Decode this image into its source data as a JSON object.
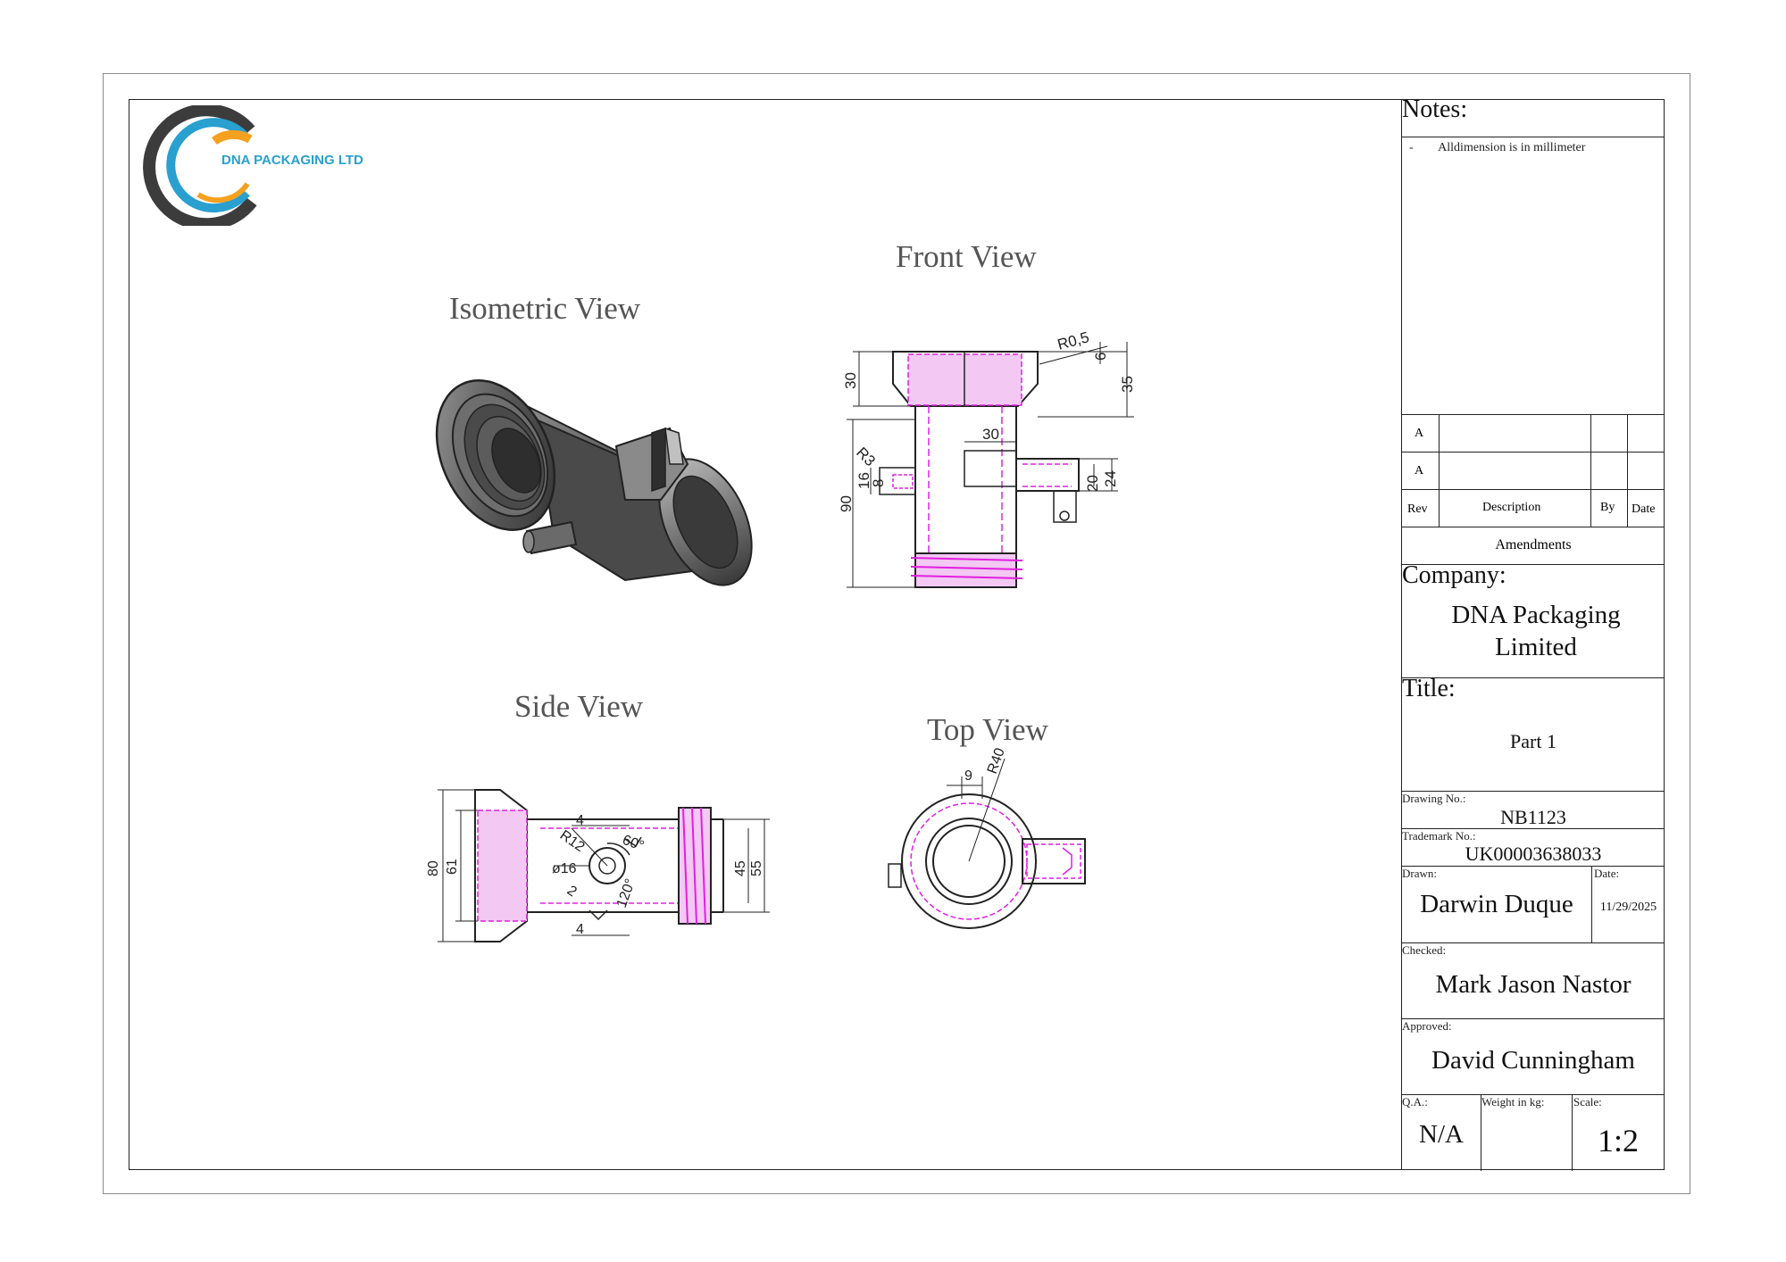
{
  "logo": {
    "text": "DNA PACKAGING LTD",
    "colors": {
      "dark": "#3c3c3c",
      "blue": "#2aa0d0",
      "orange": "#f5a01e"
    }
  },
  "views": {
    "isometric": "Isometric View",
    "front": "Front View",
    "side": "Side View",
    "top": "Top View"
  },
  "dimensions": {
    "front": [
      "R0,5",
      "6",
      "35",
      "30",
      "30",
      "R3",
      "16",
      "8",
      "90",
      "20",
      "24"
    ],
    "side": [
      "80",
      "61",
      "4",
      "R12",
      "60°",
      "ø16",
      "2",
      "120°",
      "4",
      "45",
      "55"
    ],
    "top": [
      "9",
      "R40"
    ]
  },
  "notes": {
    "heading": "Notes:",
    "items": [
      {
        "bullet": "-",
        "text": "Alldimension is in millimeter"
      }
    ]
  },
  "revisions": {
    "rows": [
      {
        "rev": "A"
      },
      {
        "rev": "A"
      }
    ],
    "headers": {
      "rev": "Rev",
      "description": "Description",
      "by": "By",
      "date": "Date"
    },
    "caption": "Amendments"
  },
  "company": {
    "label": "Company:",
    "name_line1": "DNA Packaging",
    "name_line2": "Limited"
  },
  "title": {
    "label": "Title:",
    "value": "Part 1"
  },
  "drawing_no": {
    "label": "Drawing No.:",
    "value": "NB1123"
  },
  "trademark_no": {
    "label": "Trademark No.:",
    "value": "UK00003638033"
  },
  "drawn": {
    "label": "Drawn:",
    "value": "Darwin Duque"
  },
  "date": {
    "label": "Date:",
    "value": "11/29/2025"
  },
  "checked": {
    "label": "Checked:",
    "value": "Mark Jason Nastor"
  },
  "approved": {
    "label": "Approved:",
    "value": "David Cunningham"
  },
  "qa": {
    "label": "Q.A.:",
    "value": "N/A"
  },
  "weight": {
    "label": "Weight in kg:",
    "value": ""
  },
  "scale": {
    "label": "Scale:",
    "value": "1:2"
  },
  "colors": {
    "hidden_lines": "#e020e0",
    "outline": "#222222",
    "view_title": "#555555"
  }
}
